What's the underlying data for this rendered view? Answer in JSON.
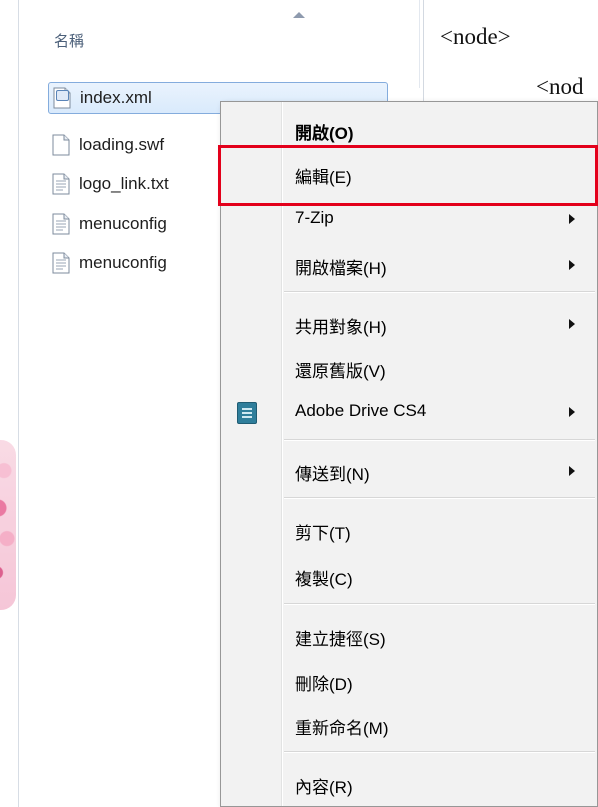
{
  "file_list": {
    "column_header": "名稱",
    "files": [
      {
        "name": "index.xml",
        "icon": "xml-file-icon",
        "selected": true
      },
      {
        "name": "loading.swf",
        "icon": "file-icon",
        "selected": false
      },
      {
        "name": "logo_link.txt",
        "icon": "text-file-icon",
        "selected": false
      },
      {
        "name": "menuconfig",
        "icon": "text-file-icon",
        "selected": false
      },
      {
        "name": "menuconfig",
        "icon": "text-file-icon",
        "selected": false
      }
    ]
  },
  "editor": {
    "lines": [
      "<node>",
      "<nod"
    ]
  },
  "context_menu": {
    "items": [
      {
        "label": "開啟(O)",
        "bold": true
      },
      {
        "label": "編輯(E)",
        "highlighted": true
      },
      {
        "label": "7-Zip",
        "submenu": true
      },
      {
        "label": "開啟檔案(H)",
        "submenu": true
      },
      {
        "label": "共用對象(H)",
        "submenu": true
      },
      {
        "label": "還原舊版(V)"
      },
      {
        "label": "Adobe Drive CS4",
        "submenu": true,
        "icon": "adobe-drive-icon"
      },
      {
        "label": "傳送到(N)",
        "submenu": true
      },
      {
        "label": "剪下(T)"
      },
      {
        "label": "複製(C)"
      },
      {
        "label": "建立捷徑(S)"
      },
      {
        "label": "刪除(D)"
      },
      {
        "label": "重新命名(M)"
      },
      {
        "label": "內容(R)"
      }
    ],
    "highlight_color": "#e3001b"
  }
}
